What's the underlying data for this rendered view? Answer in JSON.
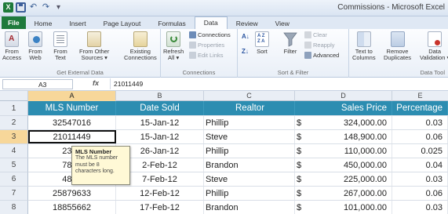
{
  "window": {
    "title": "Commissions - Microsoft Excel"
  },
  "qat": {
    "excel_icon": "X",
    "save_icon": "save-icon",
    "undo": "↶",
    "redo": "↷",
    "customize": "▾"
  },
  "tabs": [
    {
      "label": "File",
      "active": false
    },
    {
      "label": "Home",
      "active": false
    },
    {
      "label": "Insert",
      "active": false
    },
    {
      "label": "Page Layout",
      "active": false
    },
    {
      "label": "Formulas",
      "active": false
    },
    {
      "label": "Data",
      "active": true
    },
    {
      "label": "Review",
      "active": false
    },
    {
      "label": "View",
      "active": false
    }
  ],
  "ribbon": {
    "get_external_data": {
      "label": "Get External Data",
      "buttons": [
        {
          "line1": "From",
          "line2": "Access"
        },
        {
          "line1": "From",
          "line2": "Web"
        },
        {
          "line1": "From",
          "line2": "Text"
        },
        {
          "line1": "From Other",
          "line2": "Sources ▾"
        },
        {
          "line1": "Existing",
          "line2": "Connections"
        }
      ]
    },
    "connections": {
      "label": "Connections",
      "refresh": {
        "line1": "Refresh",
        "line2": "All ▾"
      },
      "connections_btn": "Connections",
      "properties_btn": "Properties",
      "edit_links_btn": "Edit Links"
    },
    "sort_filter": {
      "label": "Sort & Filter",
      "sort": "Sort",
      "filter": "Filter",
      "clear": "Clear",
      "reapply": "Reapply",
      "advanced": "Advanced"
    },
    "data_tools": {
      "label": "Data Tool",
      "text_to_columns": {
        "line1": "Text to",
        "line2": "Columns"
      },
      "remove_duplicates": {
        "line1": "Remove",
        "line2": "Duplicates"
      },
      "data_validation": {
        "line1": "Data",
        "line2": "Validation ▾"
      }
    }
  },
  "formula_bar": {
    "name_box": "A3",
    "fx": "fx",
    "value": "21011449"
  },
  "columns": [
    "A",
    "B",
    "C",
    "D",
    "E"
  ],
  "table": {
    "headers": [
      "MLS Number",
      "Date Sold",
      "Realtor",
      "Sales Price",
      "Percentage"
    ],
    "rows": [
      {
        "row": "2",
        "mls": "32547016",
        "date": "15-Jan-12",
        "realtor": "Phillip",
        "currency": "$",
        "price": "324,000.00",
        "pct": "0.03"
      },
      {
        "row": "3",
        "mls": "21011449",
        "date": "15-Jan-12",
        "realtor": "Steve",
        "currency": "$",
        "price": "148,900.00",
        "pct": "0.06"
      },
      {
        "row": "4",
        "mls": "2338",
        "date": "26-Jan-12",
        "realtor": "Phillip",
        "currency": "$",
        "price": "110,000.00",
        "pct": "0.025"
      },
      {
        "row": "5",
        "mls": "7852",
        "date": "2-Feb-12",
        "realtor": "Brandon",
        "currency": "$",
        "price": "450,000.00",
        "pct": "0.04"
      },
      {
        "row": "6",
        "mls": "4876",
        "date": "7-Feb-12",
        "realtor": "Steve",
        "currency": "$",
        "price": "225,000.00",
        "pct": "0.03"
      },
      {
        "row": "7",
        "mls": "25879633",
        "date": "12-Feb-12",
        "realtor": "Phillip",
        "currency": "$",
        "price": "267,000.00",
        "pct": "0.06"
      },
      {
        "row": "8",
        "mls": "18855662",
        "date": "17-Feb-12",
        "realtor": "Brandon",
        "currency": "$",
        "price": "101,000.00",
        "pct": "0.03"
      }
    ]
  },
  "tooltip": {
    "title": "MLS Number",
    "body": "The MLS number must be 8 characters long."
  },
  "colors": {
    "header_fill": "#2c8db1",
    "file_tab": "#1f7a3c",
    "tooltip_bg": "#fff9d6"
  }
}
